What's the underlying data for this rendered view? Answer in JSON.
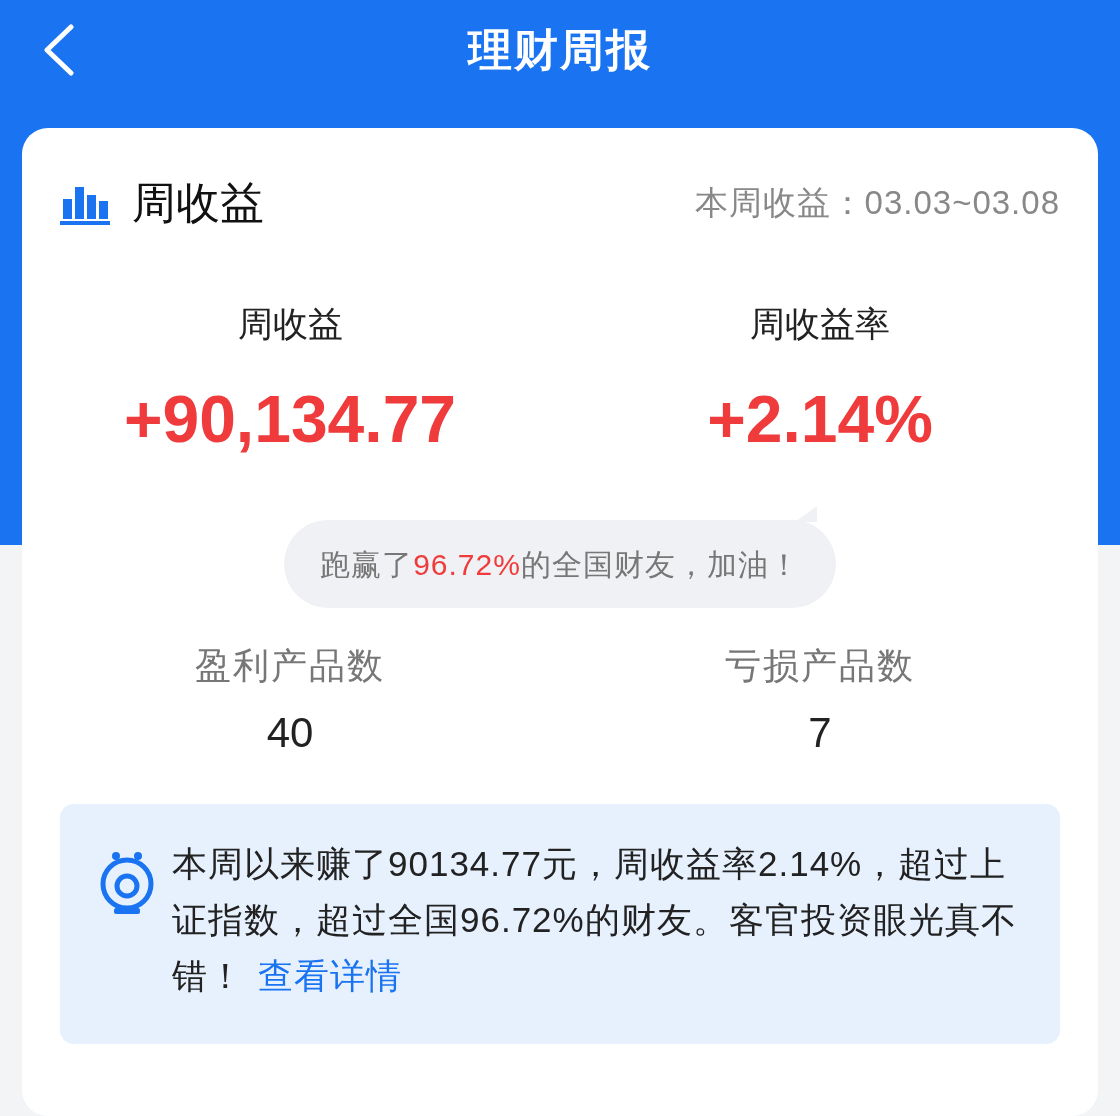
{
  "header": {
    "title": "理财周报"
  },
  "section": {
    "title": "周收益",
    "period": "本周收益：03.03~03.08"
  },
  "stats": [
    {
      "label": "周收益",
      "value": "+90,134.77"
    },
    {
      "label": "周收益率",
      "value": "+2.14%"
    }
  ],
  "rank_bubble": {
    "before": "跑赢了",
    "highlight": "96.72%",
    "after": "的全国财友，加油！"
  },
  "counts": [
    {
      "label": "盈利产品数",
      "value": "40"
    },
    {
      "label": "亏损产品数",
      "value": "7"
    }
  ],
  "summary": {
    "text": "本周以来赚了90134.77元，周收益率2.14%，超过上证指数，超过全国96.72%的财友。客官投资眼光真不错！",
    "link": "查看详情"
  }
}
